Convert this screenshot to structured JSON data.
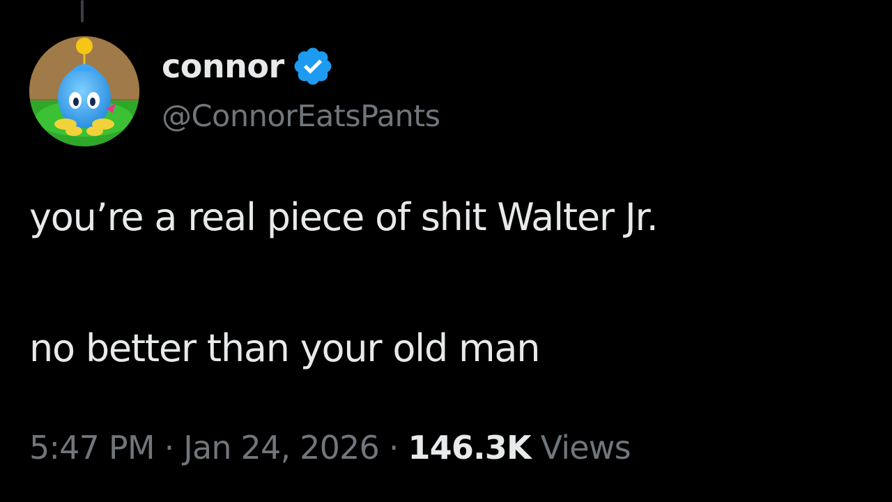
{
  "author": {
    "display_name": "connor",
    "handle": "@ConnorEatsPants",
    "verified": true,
    "avatar_icon": "chao-avatar-icon",
    "badge_color": "#1d9bf0"
  },
  "tweet": {
    "lines": [
      "you’re a real piece of shit Walter Jr.",
      "no better than your old man"
    ]
  },
  "meta": {
    "time": "5:47 PM",
    "separator": " · ",
    "date": "Jan 24, 2026",
    "views_count": "146.3K",
    "views_label": " Views"
  },
  "colors": {
    "background": "#000000",
    "primary_text": "#e7e9ea",
    "secondary_text": "#71767b"
  }
}
